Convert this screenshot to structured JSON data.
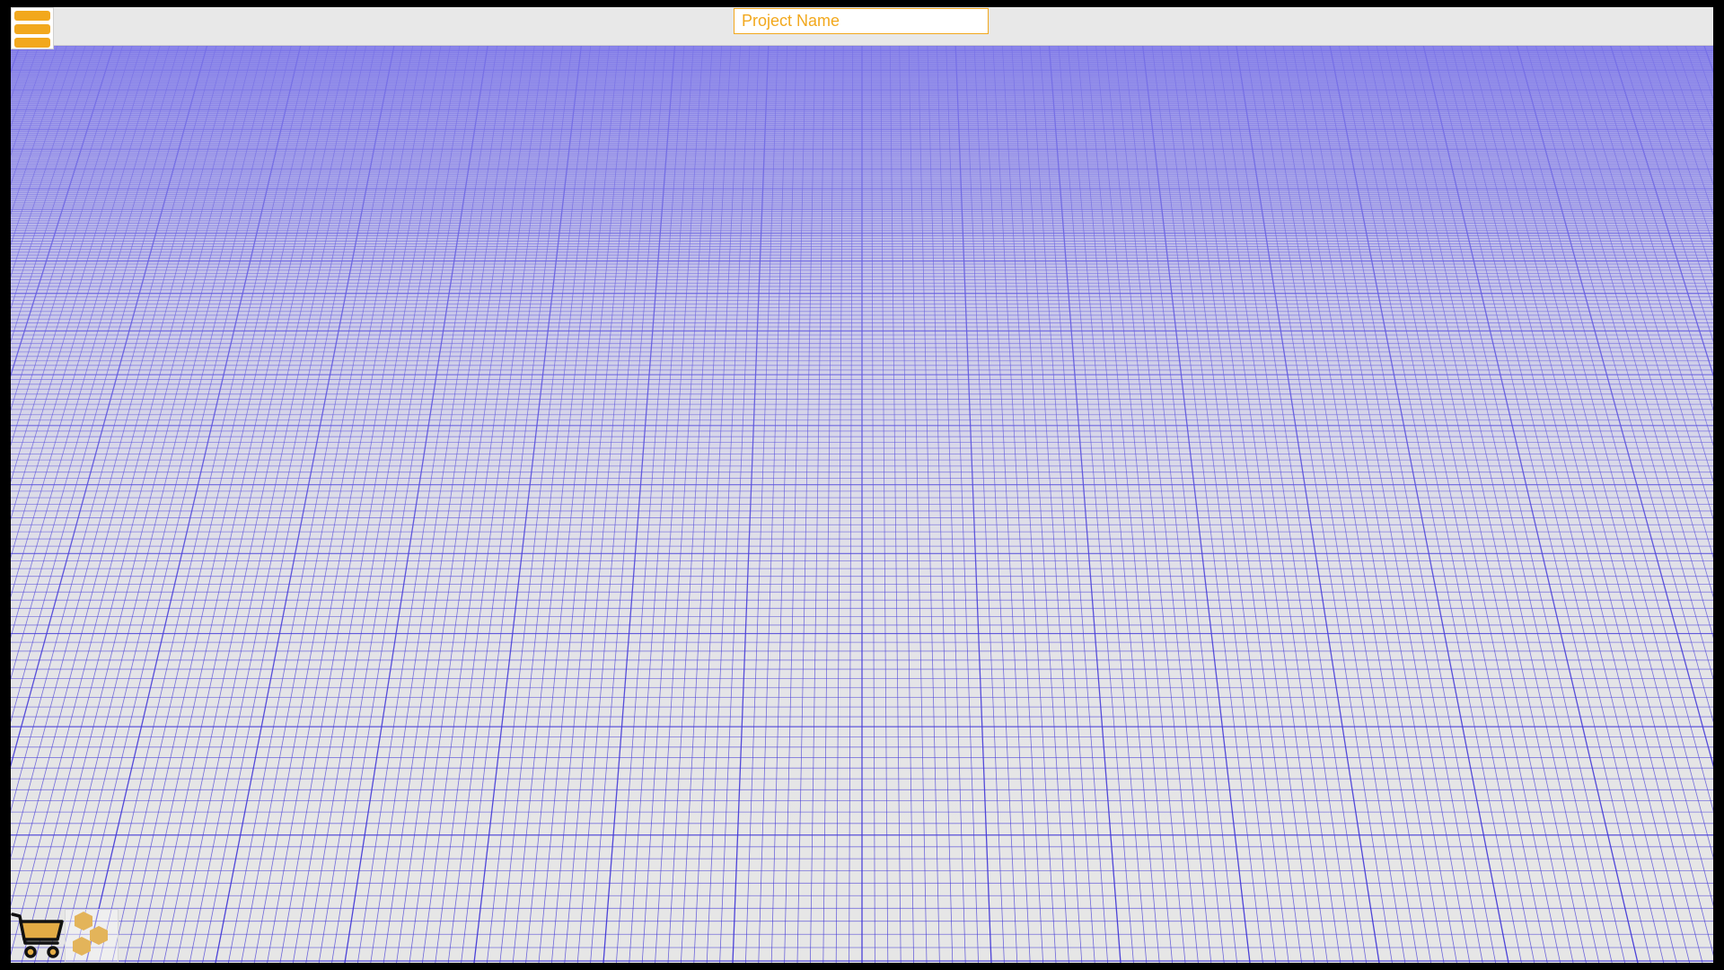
{
  "top_bar": {
    "project_name_placeholder": "Project Name",
    "project_name_value": ""
  },
  "menu": {
    "icon": "hamburger-menu-icon"
  },
  "bottom_tools": {
    "cart_icon": "shopping-cart-icon",
    "parts_icon": "hexagon-cluster-icon"
  },
  "colors": {
    "accent": "#f2a81d",
    "grid_line": "#3a2fd6",
    "background": "#e6e6e6",
    "frame": "#000000"
  }
}
